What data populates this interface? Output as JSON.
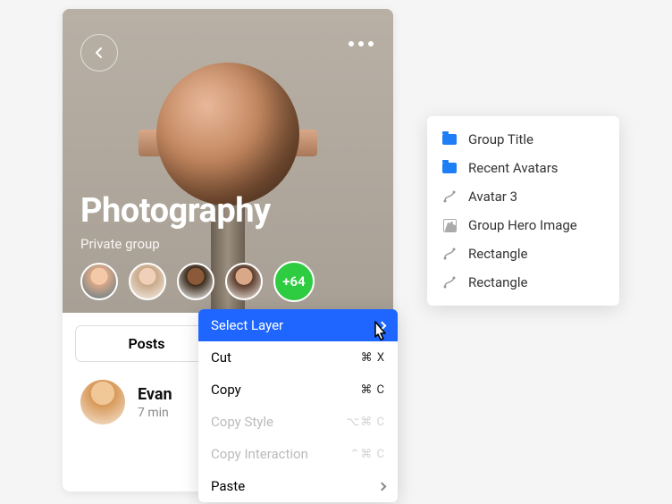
{
  "group": {
    "title": "Photography",
    "subtitle": "Private group",
    "more_count": "+64"
  },
  "tabs": {
    "posts": "Posts"
  },
  "post": {
    "author": "Evan",
    "time": "7 min"
  },
  "context_menu": {
    "select_layer": "Select Layer",
    "cut": {
      "label": "Cut",
      "shortcut": "⌘ X"
    },
    "copy": {
      "label": "Copy",
      "shortcut": "⌘ C"
    },
    "copy_style": {
      "label": "Copy Style",
      "shortcut": "⌥⌘ C"
    },
    "copy_interaction": {
      "label": "Copy Interaction",
      "shortcut": "⌃⌘ C"
    },
    "paste": {
      "label": "Paste"
    }
  },
  "layer_menu": {
    "items": [
      {
        "label": "Group Title",
        "icon": "folder"
      },
      {
        "label": "Recent Avatars",
        "icon": "folder"
      },
      {
        "label": "Avatar 3",
        "icon": "path"
      },
      {
        "label": "Group Hero Image",
        "icon": "image"
      },
      {
        "label": "Rectangle",
        "icon": "path"
      },
      {
        "label": "Rectangle",
        "icon": "path"
      }
    ]
  }
}
